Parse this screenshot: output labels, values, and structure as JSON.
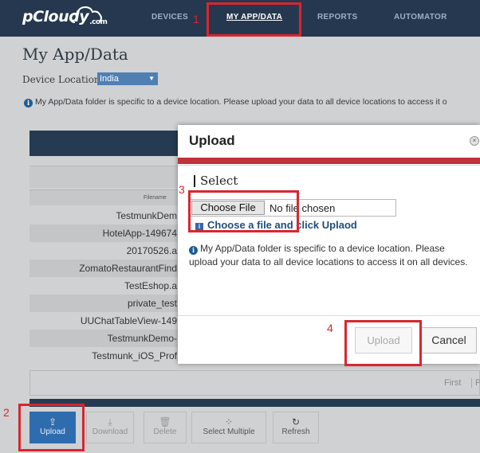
{
  "header": {
    "logo": "pCloudy",
    "logo_suffix": ".com",
    "nav": [
      "DEVICES",
      "MY APP/DATA",
      "REPORTS",
      "AUTOMATOR"
    ]
  },
  "page": {
    "title": "My App/Data",
    "location_label": "Device Location",
    "location_value": "India",
    "info_text": "My App/Data folder is specific to a device location. Please upload your data to all device locations to access it o",
    "column_filename": "Filename",
    "files": [
      "TestmunkDem",
      "HotelApp-149674",
      "20170526.a",
      "ZomatoRestaurantFind",
      "TestEshop.a",
      "private_test",
      "UUChatTableView-149",
      "TestmunkDemo-",
      "Testmunk_iOS_Prof"
    ],
    "pager": {
      "first": "First",
      "prev": "P"
    }
  },
  "actions": {
    "upload": "Upload",
    "download": "Download",
    "delete": "Delete",
    "select_multiple": "Select Multiple",
    "refresh": "Refresh"
  },
  "modal": {
    "title": "Upload",
    "section": "Select",
    "choose_file": "Choose File",
    "file_status": "No file chosen",
    "hint": "Choose a file and click Uplaod",
    "info": "My App/Data folder is specific to a device location. Please upload your data to all device locations to access it on all devices.",
    "upload_button": "Upload",
    "cancel_button": "Cancel"
  },
  "annotations": [
    "1",
    "2",
    "3",
    "4"
  ],
  "colors": {
    "navbar": "#25384f",
    "accent_red": "#d8262f",
    "primary_blue": "#2f6cae",
    "hint_blue": "#1f4e79"
  }
}
